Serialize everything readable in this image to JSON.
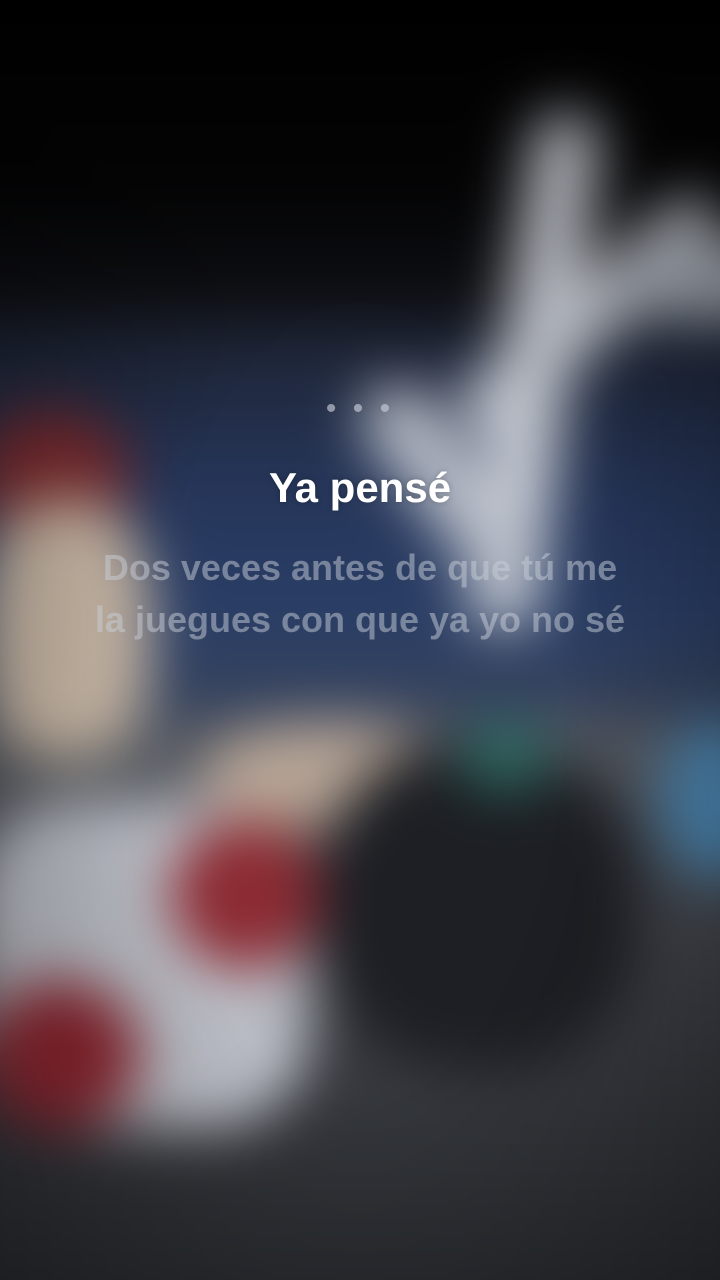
{
  "background": {
    "description_icon": "blurred-album-art",
    "accent_colors": [
      "#000000",
      "#2a3e66",
      "#8c2a32",
      "#c8ccd4"
    ]
  },
  "lyrics": {
    "instrumental_indicator": "• • •",
    "current_line": "Ya pensé",
    "next_line": "Dos veces antes de que tú me la juegues con que ya yo no sé"
  }
}
